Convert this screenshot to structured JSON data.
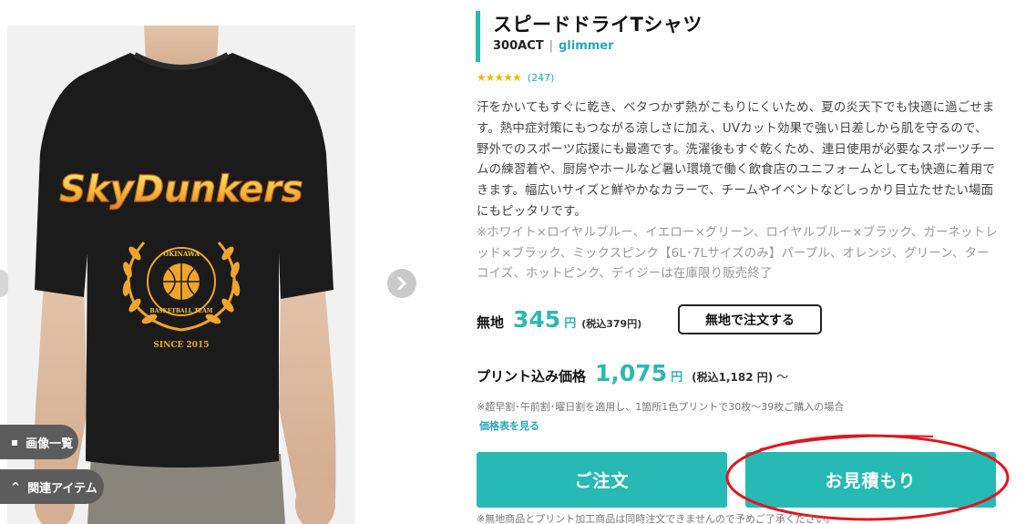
{
  "product": {
    "title": "スピードドライTシャツ",
    "code": "300ACT",
    "separator": "|",
    "brand": "glimmer",
    "stars": "★★★★★",
    "review_count": "(247)",
    "description": "汗をかいてもすぐに乾き、ベタつかず熱がこもりにくいため、夏の炎天下でも快適に過ごせます。熱中症対策にもつながる涼しさに加え、UVカット効果で強い日差しから肌を守るので、野外でのスポーツ応援にも最適です。洗濯後もすぐ乾くため、連日使用が必要なスポーツチームの練習着や、厨房やホールなど暑い環境で働く飲食店のユニフォームとしても快適に着用できます。幅広いサイズと鮮やかなカラーで、チームやイベントなどしっかり目立たせたい場面にもピッタリです。",
    "color_note": "※ホワイト×ロイヤルブルー、イエロー×グリーン、ロイヤルブルー×ブラック、ガーネットレッド×ブラック、ミックスピンク【6L･7Lサイズのみ】パープル、オレンジ、グリーン、ターコイズ、ホットピンク、デイジーは在庫限り販売終了"
  },
  "image": {
    "print_text_main": "SkyDunkers",
    "print_text_ring": "OKINAWA",
    "print_text_ring2": "BASKETBALL TEAM",
    "print_text_since": "SINCE 2015",
    "images_button": "画像一覧",
    "related_button": "関連アイテム",
    "next_icon": "chevron-right-icon"
  },
  "pricing": {
    "plain_label": "無地",
    "plain_price": "345",
    "yen": "円",
    "plain_tax": "(税込379円)",
    "plain_order_button": "無地で注文する",
    "print_label": "プリント込み価格",
    "print_price": "1,075",
    "print_tax": "(税込1,182 円)",
    "tilde": "～",
    "print_note": "※超早割･午前割･曜日割を適用し、1箇所1色プリントで30枚～39枚ご購入の場合",
    "price_table_link": "価格表を見る"
  },
  "actions": {
    "order_button": "ご注文",
    "estimate_button": "お見積もり",
    "bottom_note": "※無地商品とプリント加工商品は同時注文できませんので予めご了承ください。"
  },
  "colors": {
    "accent": "#27b9b3",
    "link": "#2aa7b8",
    "annotation": "#e0161e",
    "shirt": "#1b1b1b"
  }
}
